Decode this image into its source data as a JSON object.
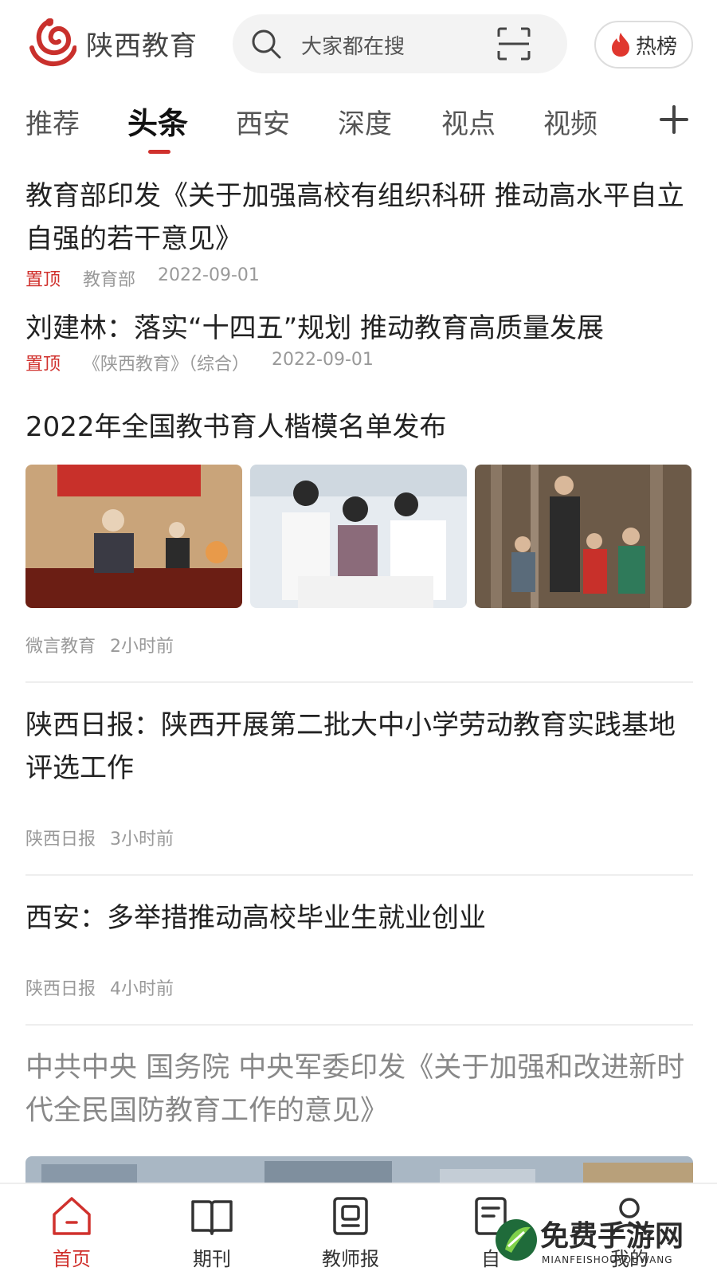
{
  "header": {
    "app_name": "陕西教育",
    "search_placeholder": "大家都在搜",
    "hot_label": "热榜"
  },
  "tabs": [
    {
      "label": "推荐"
    },
    {
      "label": "头条",
      "active": true
    },
    {
      "label": "西安"
    },
    {
      "label": "深度"
    },
    {
      "label": "视点"
    },
    {
      "label": "视频"
    }
  ],
  "feed": {
    "items": [
      {
        "title": "教育部印发《关于加强高校有组织科研 推动高水平自立自强的若干意见》",
        "pin": "置顶",
        "source": "教育部",
        "time": "2022-09-01"
      },
      {
        "title": "刘建林：落实“十四五”规划  推动教育高质量发展",
        "pin": "置顶",
        "source": "《陕西教育》（综合）",
        "time": "2022-09-01"
      },
      {
        "title": "2022年全国教书育人楷模名单发布",
        "source": "微言教育",
        "time": "2小时前"
      },
      {
        "title": "陕西日报：陕西开展第二批大中小学劳动教育实践基地评选工作",
        "source": "陕西日报",
        "time": "3小时前"
      },
      {
        "title": "西安：多举措推动高校毕业生就业创业",
        "source": "陕西日报",
        "time": "4小时前"
      },
      {
        "title": "中共中央 国务院 中央军委印发《关于加强和改进新时代全民国防教育工作的意见》"
      }
    ]
  },
  "bottom_nav": [
    {
      "label": "首页",
      "active": true
    },
    {
      "label": "期刊"
    },
    {
      "label": "教师报"
    },
    {
      "label": "自"
    },
    {
      "label": "我的"
    }
  ],
  "watermark": {
    "text": "免费手游网",
    "sub": "MIANFEISHOUYOUWANG"
  },
  "colors": {
    "accent": "#d0312d",
    "text": "#222222",
    "muted": "#999999"
  }
}
